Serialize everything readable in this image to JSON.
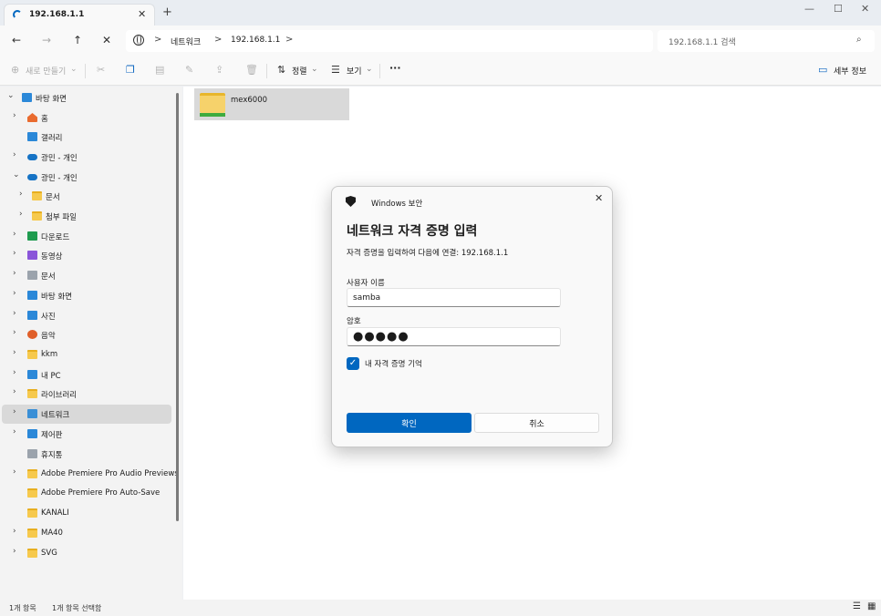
{
  "tab": {
    "title": "192.168.1.1",
    "close": "✕",
    "new_tab": "+"
  },
  "window": {
    "minimize": "—",
    "maximize": "☐",
    "close": "✕"
  },
  "nav": {
    "back": "←",
    "forward": "→",
    "up": "↑",
    "refresh": "✕"
  },
  "address": {
    "crumbs": [
      "네트워크",
      "192.168.1.1"
    ],
    "sep": ">"
  },
  "search": {
    "placeholder": "192.168.1.1 검색",
    "icon": "⌕"
  },
  "commandbar": {
    "new_label": "새로 만들기",
    "sort_label": "정렬",
    "view_label": "보기",
    "more": "···",
    "details_label": "세부 정보"
  },
  "sidebar": {
    "items": [
      {
        "label": "바탕 화면",
        "icon": "desktop-icon"
      },
      {
        "label": "홈",
        "icon": "home-icon"
      },
      {
        "label": "갤러리",
        "icon": "gallery-icon"
      },
      {
        "label": "광민 - 개인",
        "icon": "onedrive-icon"
      },
      {
        "label": "광민 - 개인",
        "icon": "onedrive-icon"
      },
      {
        "label": "문서",
        "icon": "folder-icon"
      },
      {
        "label": "첨부 파일",
        "icon": "folder-icon"
      },
      {
        "label": "다운로드",
        "icon": "download-icon"
      },
      {
        "label": "동영상",
        "icon": "video-icon"
      },
      {
        "label": "문서",
        "icon": "documents-icon"
      },
      {
        "label": "바탕 화면",
        "icon": "desktop-icon"
      },
      {
        "label": "사진",
        "icon": "pictures-icon"
      },
      {
        "label": "음악",
        "icon": "music-icon"
      },
      {
        "label": "kkm",
        "icon": "folder-icon"
      },
      {
        "label": "내 PC",
        "icon": "pc-icon"
      },
      {
        "label": "라이브러리",
        "icon": "folder-icon"
      },
      {
        "label": "네트워크",
        "icon": "network-icon"
      },
      {
        "label": "제어판",
        "icon": "control-panel-icon"
      },
      {
        "label": "휴지통",
        "icon": "recycle-bin-icon"
      },
      {
        "label": "Adobe Premiere Pro Audio Previews",
        "icon": "folder-icon"
      },
      {
        "label": "Adobe Premiere Pro Auto-Save",
        "icon": "folder-icon"
      },
      {
        "label": "KANALI",
        "icon": "folder-icon"
      },
      {
        "label": "MA40",
        "icon": "folder-icon"
      },
      {
        "label": "SVG",
        "icon": "folder-icon"
      }
    ]
  },
  "main": {
    "item_name": "mex6000"
  },
  "status": {
    "count": "1개 항목",
    "selected": "1개 항목 선택함"
  },
  "dialog": {
    "app_title": "Windows 보안",
    "heading": "네트워크 자격 증명 입력",
    "description": "자격 증명을 입력하여 다음에 연결: 192.168.1.1",
    "username_label": "사용자 이름",
    "username_value": "samba",
    "password_label": "암호",
    "password_value": "●●●●●",
    "remember_label": "내 자격 증명 기억",
    "remember_checked": true,
    "ok_label": "확인",
    "cancel_label": "취소",
    "close": "✕"
  },
  "colors": {
    "accent": "#0067c0",
    "selection": "#d9d9d9"
  }
}
